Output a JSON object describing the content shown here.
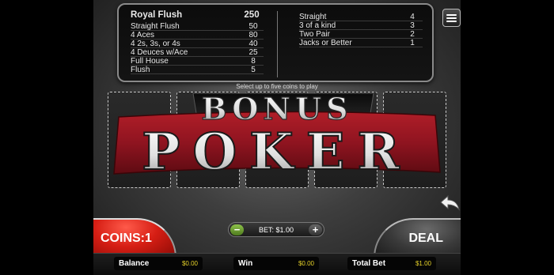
{
  "paytable": {
    "left": [
      {
        "hand": "Royal Flush",
        "pay": "250"
      },
      {
        "hand": "Straight Flush",
        "pay": "50"
      },
      {
        "hand": "4 Aces",
        "pay": "80"
      },
      {
        "hand": "4 2s, 3s, or 4s",
        "pay": "40"
      },
      {
        "hand": "4 Deuces w/Ace",
        "pay": "25"
      },
      {
        "hand": "Full House",
        "pay": "8"
      },
      {
        "hand": "Flush",
        "pay": "5"
      }
    ],
    "right": [
      {
        "hand": "Straight",
        "pay": "4"
      },
      {
        "hand": "3 of a kind",
        "pay": "3"
      },
      {
        "hand": "Two Pair",
        "pay": "2"
      },
      {
        "hand": "Jacks or Better",
        "pay": "1"
      }
    ]
  },
  "hint": "Select up to five coins to play",
  "logo": {
    "line1": "BONUS",
    "line2": "POKER",
    "accent": "#8f1420"
  },
  "controls": {
    "coins": "COINS:1",
    "bet": "BET: $1.00",
    "minus": "−",
    "plus": "+",
    "deal": "DEAL"
  },
  "status": {
    "balance_label": "Balance",
    "balance_value": "$0.00",
    "win_label": "Win",
    "win_value": "$0.00",
    "total_bet_label": "Total Bet",
    "total_bet_value": "$1.00"
  },
  "icons": {
    "menu": "hamburger-menu-icon",
    "back": "back-arrow-icon"
  },
  "colors": {
    "coins_button": "#d61e14",
    "bet_minus": "#6fa035",
    "value_text": "#e6d22a"
  }
}
